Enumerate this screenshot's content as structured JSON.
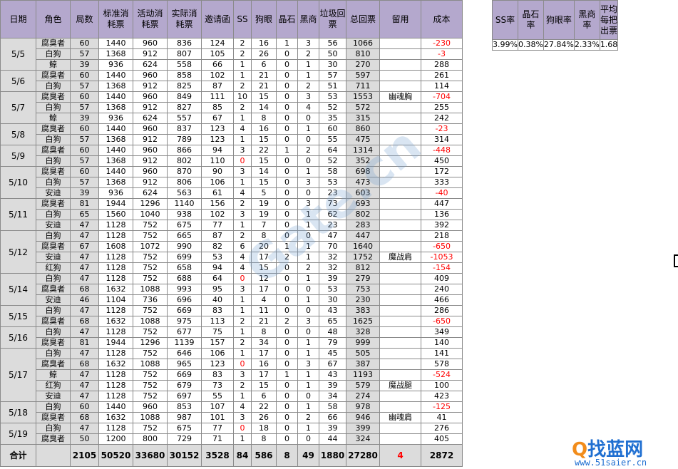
{
  "headers": [
    "日期",
    "角色",
    "局数",
    "标准消耗票",
    "活动消耗票",
    "实际消耗票",
    "邀请函",
    "SS",
    "狗眼",
    "晶石",
    "黑商",
    "垃圾回票",
    "总回票",
    "留用",
    "成本"
  ],
  "rows": [
    {
      "date": "5/5",
      "span": 3,
      "role": "腐臭者",
      "c": [
        "60",
        "1440",
        "960",
        "836",
        "124",
        "2",
        "16",
        "1",
        "3",
        "56",
        "1066"
      ],
      "keep": "",
      "cost": "-230"
    },
    {
      "role": "白狗",
      "c": [
        "57",
        "1368",
        "912",
        "807",
        "105",
        "2",
        "26",
        "0",
        "2",
        "50",
        "810"
      ],
      "keep": "",
      "cost": "-3"
    },
    {
      "role": "鲸",
      "c": [
        "39",
        "936",
        "624",
        "558",
        "66",
        "1",
        "6",
        "0",
        "1",
        "30",
        "270"
      ],
      "keep": "",
      "cost": "288"
    },
    {
      "date": "5/6",
      "span": 2,
      "role": "腐臭者",
      "c": [
        "60",
        "1440",
        "960",
        "858",
        "102",
        "1",
        "21",
        "0",
        "1",
        "57",
        "597"
      ],
      "keep": "",
      "cost": "261"
    },
    {
      "role": "白狗",
      "c": [
        "57",
        "1368",
        "912",
        "825",
        "87",
        "2",
        "21",
        "0",
        "2",
        "51",
        "711"
      ],
      "keep": "",
      "cost": "114"
    },
    {
      "date": "5/7",
      "span": 3,
      "role": "腐臭者",
      "c": [
        "60",
        "1440",
        "960",
        "849",
        "111",
        "10",
        "15",
        "0",
        "3",
        "53",
        "1553"
      ],
      "keep": "幽魂胸",
      "cost": "-704"
    },
    {
      "role": "白狗",
      "c": [
        "57",
        "1368",
        "912",
        "827",
        "85",
        "2",
        "14",
        "0",
        "4",
        "52",
        "572"
      ],
      "keep": "",
      "cost": "255"
    },
    {
      "role": "鲸",
      "c": [
        "39",
        "936",
        "624",
        "557",
        "67",
        "1",
        "8",
        "0",
        "0",
        "35",
        "315"
      ],
      "keep": "",
      "cost": "242"
    },
    {
      "date": "5/8",
      "span": 2,
      "role": "腐臭者",
      "c": [
        "60",
        "1440",
        "960",
        "837",
        "123",
        "4",
        "16",
        "0",
        "1",
        "60",
        "860"
      ],
      "keep": "",
      "cost": "-23"
    },
    {
      "role": "白狗",
      "c": [
        "57",
        "1368",
        "912",
        "789",
        "123",
        "1",
        "15",
        "0",
        "0",
        "55",
        "475"
      ],
      "keep": "",
      "cost": "314"
    },
    {
      "date": "5/9",
      "span": 2,
      "role": "腐臭者",
      "c": [
        "60",
        "1440",
        "960",
        "866",
        "94",
        "3",
        "22",
        "1",
        "2",
        "64",
        "1314"
      ],
      "keep": "",
      "cost": "-448"
    },
    {
      "role": "白狗",
      "c": [
        "57",
        "1368",
        "912",
        "802",
        "110",
        "0",
        "15",
        "0",
        "0",
        "52",
        "352"
      ],
      "keep": "",
      "cost": "450"
    },
    {
      "date": "5/10",
      "span": 3,
      "role": "腐臭者",
      "c": [
        "60",
        "1440",
        "960",
        "870",
        "90",
        "3",
        "14",
        "0",
        "1",
        "58",
        "698"
      ],
      "keep": "",
      "cost": "172"
    },
    {
      "role": "白狗",
      "c": [
        "57",
        "1368",
        "912",
        "806",
        "106",
        "1",
        "15",
        "0",
        "3",
        "53",
        "473"
      ],
      "keep": "",
      "cost": "333"
    },
    {
      "role": "安迪",
      "c": [
        "39",
        "936",
        "624",
        "563",
        "61",
        "4",
        "5",
        "0",
        "0",
        "23",
        "603"
      ],
      "keep": "",
      "cost": "-40"
    },
    {
      "date": "5/11",
      "span": 3,
      "role": "腐臭者",
      "c": [
        "81",
        "1944",
        "1296",
        "1140",
        "156",
        "2",
        "19",
        "0",
        "3",
        "73",
        "693"
      ],
      "keep": "",
      "cost": "447"
    },
    {
      "role": "白狗",
      "c": [
        "65",
        "1560",
        "1040",
        "938",
        "102",
        "3",
        "19",
        "0",
        "1",
        "62",
        "802"
      ],
      "keep": "",
      "cost": "136"
    },
    {
      "role": "安迪",
      "c": [
        "47",
        "1128",
        "752",
        "675",
        "77",
        "1",
        "7",
        "0",
        "1",
        "23",
        "283"
      ],
      "keep": "",
      "cost": "392"
    },
    {
      "date": "5/12",
      "span": 4,
      "role": "白狗",
      "c": [
        "47",
        "1128",
        "752",
        "665",
        "87",
        "2",
        "8",
        "0",
        "0",
        "47",
        "447"
      ],
      "keep": "",
      "cost": "218"
    },
    {
      "role": "腐臭者",
      "c": [
        "67",
        "1608",
        "1072",
        "990",
        "82",
        "6",
        "20",
        "1",
        "1",
        "70",
        "1640"
      ],
      "keep": "",
      "cost": "-650"
    },
    {
      "role": "安迪",
      "c": [
        "47",
        "1128",
        "752",
        "699",
        "53",
        "4",
        "17",
        "2",
        "1",
        "32",
        "1752"
      ],
      "keep": "魔战肩",
      "cost": "-1053"
    },
    {
      "role": "红狗",
      "c": [
        "47",
        "1128",
        "752",
        "658",
        "94",
        "4",
        "15",
        "0",
        "2",
        "32",
        "812"
      ],
      "keep": "",
      "cost": "-154"
    },
    {
      "date": "5/14",
      "span": 3,
      "role": "白狗",
      "c": [
        "47",
        "1128",
        "752",
        "688",
        "64",
        "0",
        "12",
        "0",
        "1",
        "39",
        "279"
      ],
      "keep": "",
      "cost": "409"
    },
    {
      "role": "腐臭者",
      "c": [
        "68",
        "1632",
        "1088",
        "993",
        "95",
        "3",
        "17",
        "0",
        "0",
        "53",
        "753"
      ],
      "keep": "",
      "cost": "240"
    },
    {
      "role": "安迪",
      "c": [
        "46",
        "1104",
        "736",
        "696",
        "40",
        "1",
        "4",
        "0",
        "1",
        "30",
        "230"
      ],
      "keep": "",
      "cost": "466"
    },
    {
      "date": "5/15",
      "span": 2,
      "role": "白狗",
      "c": [
        "47",
        "1128",
        "752",
        "669",
        "83",
        "1",
        "11",
        "0",
        "0",
        "43",
        "383"
      ],
      "keep": "",
      "cost": "286"
    },
    {
      "role": "腐臭者",
      "c": [
        "68",
        "1632",
        "1088",
        "975",
        "113",
        "2",
        "21",
        "2",
        "3",
        "65",
        "1625"
      ],
      "keep": "",
      "cost": "-650"
    },
    {
      "date": "5/16",
      "span": 2,
      "role": "白狗",
      "c": [
        "47",
        "1128",
        "752",
        "677",
        "75",
        "1",
        "8",
        "0",
        "0",
        "48",
        "328"
      ],
      "keep": "",
      "cost": "349"
    },
    {
      "role": "腐臭者",
      "c": [
        "81",
        "1944",
        "1296",
        "1139",
        "157",
        "2",
        "34",
        "0",
        "1",
        "79",
        "999"
      ],
      "keep": "",
      "cost": "140"
    },
    {
      "date": "5/17",
      "span": 5,
      "role": "白狗",
      "c": [
        "47",
        "1128",
        "752",
        "646",
        "106",
        "1",
        "17",
        "0",
        "1",
        "45",
        "505"
      ],
      "keep": "",
      "cost": "141"
    },
    {
      "role": "腐臭者",
      "c": [
        "68",
        "1632",
        "1088",
        "965",
        "123",
        "0",
        "16",
        "0",
        "3",
        "67",
        "387"
      ],
      "keep": "",
      "cost": "578"
    },
    {
      "role": "鲸",
      "c": [
        "47",
        "1128",
        "752",
        "669",
        "83",
        "3",
        "17",
        "1",
        "1",
        "43",
        "1193"
      ],
      "keep": "",
      "cost": "-524"
    },
    {
      "role": "红狗",
      "c": [
        "47",
        "1128",
        "752",
        "679",
        "73",
        "2",
        "15",
        "0",
        "1",
        "39",
        "579"
      ],
      "keep": "魔战腿",
      "cost": "100"
    },
    {
      "role": "安迪",
      "c": [
        "47",
        "1128",
        "752",
        "697",
        "55",
        "1",
        "6",
        "0",
        "0",
        "34",
        "274"
      ],
      "keep": "",
      "cost": "423"
    },
    {
      "date": "5/18",
      "span": 2,
      "role": "白狗",
      "c": [
        "60",
        "1440",
        "960",
        "853",
        "107",
        "4",
        "22",
        "0",
        "1",
        "58",
        "978"
      ],
      "keep": "",
      "cost": "-125"
    },
    {
      "role": "腐臭者",
      "c": [
        "68",
        "1632",
        "1088",
        "987",
        "101",
        "3",
        "26",
        "0",
        "2",
        "66",
        "946"
      ],
      "keep": "幽魂肩",
      "cost": "41"
    },
    {
      "date": "5/19",
      "span": 2,
      "role": "白狗",
      "c": [
        "47",
        "1128",
        "752",
        "675",
        "77",
        "0",
        "18",
        "0",
        "1",
        "39",
        "399"
      ],
      "keep": "",
      "cost": "276"
    },
    {
      "role": "腐臭者",
      "c": [
        "50",
        "1200",
        "800",
        "729",
        "71",
        "1",
        "8",
        "0",
        "0",
        "44",
        "324"
      ],
      "keep": "",
      "cost": "405"
    }
  ],
  "total": {
    "label": "合计",
    "c": [
      "2105",
      "50520",
      "33680",
      "30152",
      "3528",
      "84",
      "586",
      "8",
      "49",
      "1880",
      "27280"
    ],
    "keep": "4",
    "cost": "2872"
  },
  "summary": {
    "headers": [
      "SS率",
      "晶石率",
      "狗眼率",
      "黑商率",
      "平均每把出票"
    ],
    "values": [
      "3.99%",
      "0.38%",
      "27.84%",
      "2.33%",
      "1.68"
    ]
  },
  "watermark": "Gate.cn",
  "logo": {
    "brand_q": "Q",
    "brand_rest": "找蓝网",
    "url": "www.51saier.cn"
  },
  "colors": {
    "header_bg": "#b4a8cd",
    "shade": "#dcdcdc",
    "negative": "#ff0000"
  }
}
